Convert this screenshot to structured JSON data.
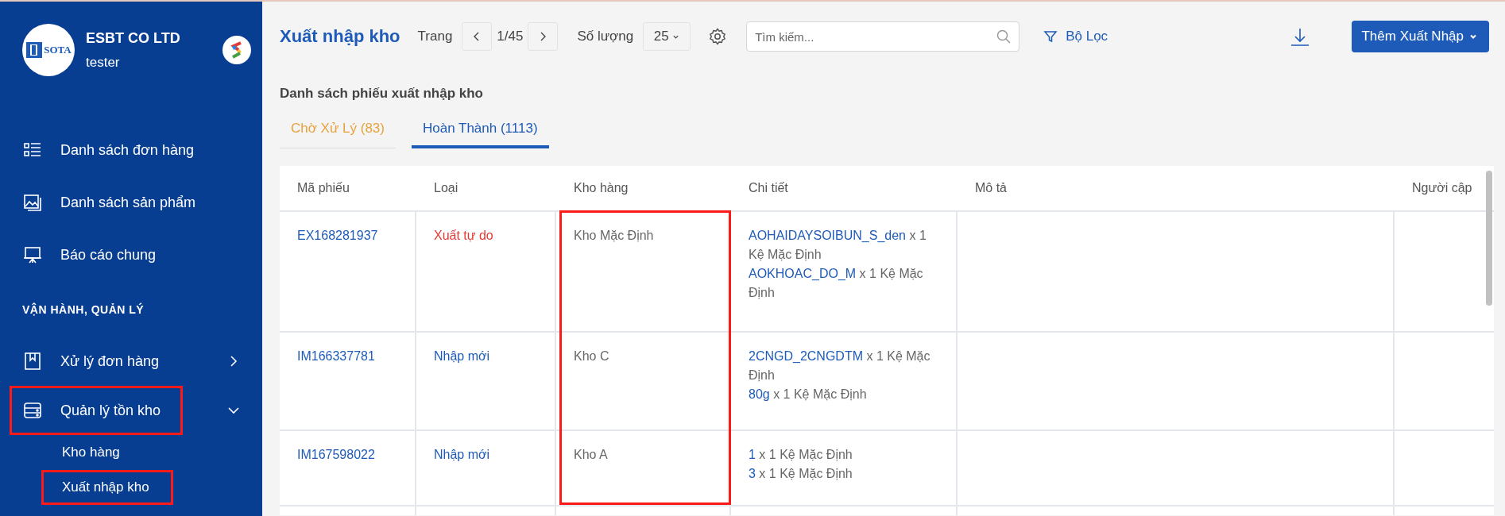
{
  "sidebar": {
    "logo_text": "SOTA",
    "company": "ESBT CO LTD",
    "user": "tester",
    "items": [
      {
        "label": "Danh sách đơn hàng",
        "selected": false
      },
      {
        "label": "Danh sách sản phẩm",
        "selected": false
      },
      {
        "label": "Báo cáo chung",
        "selected": false
      }
    ],
    "section_title": "VẬN HÀNH, QUẢN LÝ",
    "groups": [
      {
        "label": "Xử lý đơn hàng",
        "expanded": false,
        "highlighted": false
      },
      {
        "label": "Quản lý tồn kho",
        "expanded": true,
        "highlighted": true,
        "children": [
          {
            "label": "Kho hàng",
            "highlighted": false
          },
          {
            "label": "Xuất nhập kho",
            "highlighted": true
          }
        ]
      }
    ]
  },
  "toolbar": {
    "title": "Xuất nhập kho",
    "page_label": "Trang",
    "page": "1/45",
    "qty_label": "Số lượng",
    "qty": "25",
    "search": {
      "placeholder": "Tìm kiếm..."
    },
    "filter": "Bộ Lọc",
    "add_button": "Thêm Xuất Nhập"
  },
  "list_title": "Danh sách phiếu xuất nhập kho",
  "tabs": [
    {
      "label": "Chờ Xử Lý (83)",
      "selected": false
    },
    {
      "label": "Hoàn Thành (1113)",
      "selected": true
    }
  ],
  "table": {
    "columns": [
      {
        "label": "Mã phiếu",
        "highlighted": false
      },
      {
        "label": "Loại",
        "highlighted": false
      },
      {
        "label": "Kho hàng",
        "highlighted": true
      },
      {
        "label": "Chi tiết",
        "highlighted": false
      },
      {
        "label": "Mô tả",
        "highlighted": false
      },
      {
        "label": "Người cập",
        "highlighted": false
      }
    ],
    "rows": [
      {
        "code": "EX168281937",
        "type": "Xuất tự do",
        "kind": "export",
        "warehouse": "Kho Mặc Định",
        "details": [
          {
            "item": "AOHAIDAYSOIBUN_S_den",
            "rest": "x 1 Kệ Mặc Định"
          },
          {
            "item": "AOKHOAC_DO_M",
            "rest": "x 1 Kệ Mặc Định"
          }
        ]
      },
      {
        "code": "IM166337781",
        "type": "Nhập mới",
        "kind": "import",
        "warehouse": "Kho C",
        "details": [
          {
            "item": "2CNGD_2CNGDTM",
            "rest": "x 1 Kệ Mặc Định"
          },
          {
            "item": "80g",
            "rest": "x 1 Kệ Mặc Định"
          }
        ]
      },
      {
        "code": "IM167598022",
        "type": "Nhập mới",
        "kind": "import",
        "warehouse": "Kho A",
        "details": [
          {
            "item": "1",
            "rest": "x 1 Kệ Mặc Định"
          },
          {
            "item": "3",
            "rest": "x 1 Kệ Mặc Định"
          }
        ]
      }
    ]
  }
}
